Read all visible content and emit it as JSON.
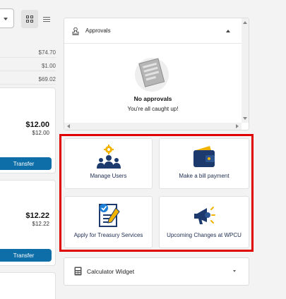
{
  "left": {
    "balances": [
      "$74.70",
      "$1.00",
      "$69.02"
    ],
    "accounts": [
      {
        "amount": "$12.00",
        "available": "$12.00",
        "transfer_label": "Transfer"
      },
      {
        "amount": "$12.22",
        "available": "$12.22",
        "transfer_label": "Transfer"
      }
    ]
  },
  "approvals": {
    "title": "Approvals",
    "empty_title": "No approvals",
    "empty_subtitle": "You're all caught up!"
  },
  "tiles": [
    {
      "label": "Manage Users",
      "icon": "manage-users-icon"
    },
    {
      "label": "Make a bill payment",
      "icon": "wallet-icon"
    },
    {
      "label": "Apply for Treasury Services",
      "icon": "checklist-icon"
    },
    {
      "label": "Upcoming Changes at WPCU",
      "icon": "megaphone-icon"
    }
  ],
  "calculator": {
    "title": "Calculator Widget"
  },
  "colors": {
    "accent": "#0e6fa8",
    "highlight": "#e00000",
    "icon_navy": "#1d3a6e",
    "icon_gold": "#f2b300"
  }
}
